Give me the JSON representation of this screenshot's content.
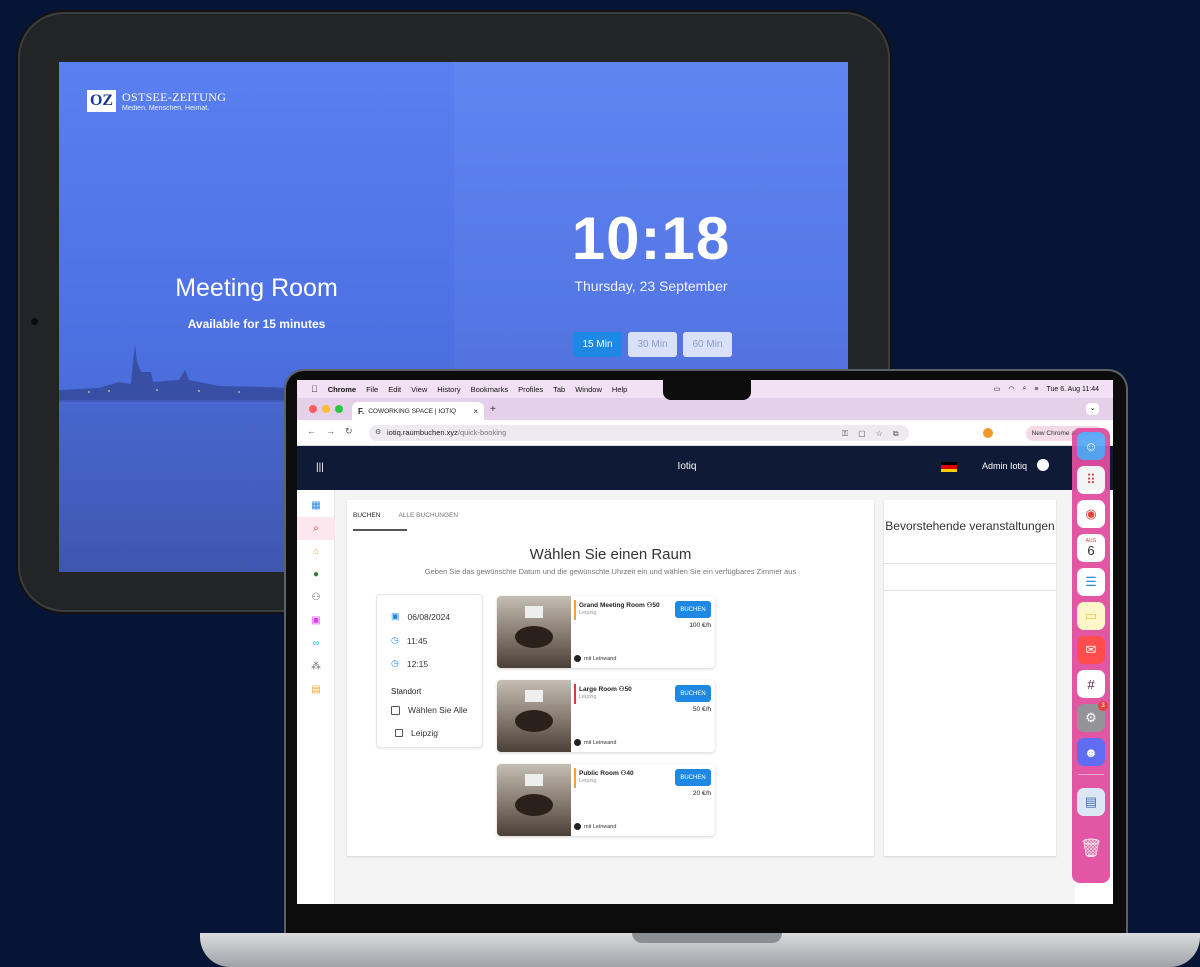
{
  "tablet": {
    "logo_mark": "OZ",
    "logo_name": "OSTSEE-ZEITUNG",
    "logo_tagline": "Medien. Menschen. Heimat.",
    "room_title": "Meeting Room",
    "room_status": "Available for 15 minutes",
    "time": "10:18",
    "date": "Thursday, 23 September",
    "durations": [
      "15 Min",
      "30 Min",
      "60 Min"
    ],
    "selected_duration": "15 Min"
  },
  "macos": {
    "menu": [
      "Chrome",
      "File",
      "Edit",
      "View",
      "History",
      "Bookmarks",
      "Profiles",
      "Tab",
      "Window",
      "Help"
    ],
    "clock": "Tue 6. Aug  11:44"
  },
  "browser": {
    "tab_title": "COWORKING SPACE | IOTIQ",
    "url_host": "iotiq.raumbuchen.xyz",
    "url_path": "/quick-booking",
    "update_label": "New Chrome available"
  },
  "app": {
    "brand": "Iotiq",
    "user": "Admin Iotiq",
    "tabs": [
      "BUCHEN",
      "ALLE BUCHUNGEN"
    ],
    "heading": "Wählen Sie einen Raum",
    "subheading": "Geben Sie das gewünschte Datum und die gewünschte Uhrzeit ein und wählen Sie ein verfügbares Zimmer aus",
    "filter": {
      "date": "06/08/2024",
      "start": "11:45",
      "end": "12:15",
      "location_label": "Standort",
      "options": [
        "Wählen Sie Alle",
        "Leipzig"
      ]
    },
    "rooms": [
      {
        "name": "Grand Meeting Room",
        "capacity": "50",
        "location": "Leipzig",
        "price": "100 €/h",
        "book": "BUCHEN",
        "equipment": "mit Leinwand",
        "accent": "#f2a531"
      },
      {
        "name": "Large Room",
        "capacity": "50",
        "location": "Leipzig",
        "price": "50 €/h",
        "book": "BUCHEN",
        "equipment": "mit Leinwand",
        "accent": "#d83b3b"
      },
      {
        "name": "Public Room",
        "capacity": "40",
        "location": "Leipzig",
        "price": "20 €/h",
        "book": "BUCHEN",
        "equipment": "mit Leinwand",
        "accent": "#f2a531"
      }
    ],
    "events_title": "Bevorstehende veranstaltungen",
    "colors": {
      "header": "#0e1a36",
      "primary": "#1e88e5",
      "sidebar_active": "#fde7ee"
    }
  },
  "dock": {
    "apps": [
      "finder-icon",
      "launchpad-icon",
      "chrome-icon",
      "calendar-icon",
      "reminders-icon",
      "notes-icon",
      "mail-icon",
      "slack-icon",
      "settings-icon",
      "discord-icon",
      "preview-icon",
      "trash-icon"
    ],
    "calendar_month": "AUG",
    "calendar_day": "6",
    "settings_badge": "3"
  }
}
